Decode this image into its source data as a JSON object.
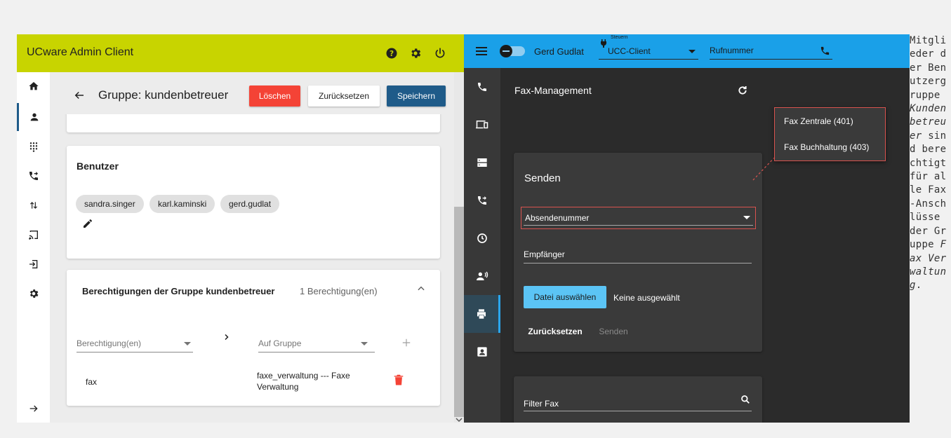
{
  "admin": {
    "title": "UCware Admin Client",
    "header_icons": [
      "help-icon",
      "gear-icon",
      "power-icon"
    ],
    "rail": [
      "home-icon",
      "person-icon",
      "dialpad-icon",
      "phone-forward-icon",
      "swap-vert-icon",
      "cast-icon",
      "login-icon",
      "gear-icon",
      "arrow-right-icon"
    ],
    "page_title": "Gruppe: kundenbetreuer",
    "buttons": {
      "delete": "Löschen",
      "reset": "Zurücksetzen",
      "save": "Speichern"
    },
    "users_card": {
      "title": "Benutzer",
      "chips": [
        "sandra.singer",
        "karl.kaminski",
        "gerd.gudlat"
      ]
    },
    "permissions_card": {
      "title": "Berechtigungen der Gruppe kundenbetreuer",
      "count": "1 Berechtigung(en)",
      "select_permission_placeholder": "Berechtigung(en)",
      "select_group_placeholder": "Auf Gruppe",
      "row": {
        "permission": "fax",
        "target": "faxe_verwaltung --- Faxe Verwaltung"
      }
    },
    "colors": {
      "header": "#c8d400",
      "delete": "#f44336",
      "save": "#1f5b89"
    }
  },
  "ucc": {
    "user_name": "Gerd Gudlat",
    "control_label": "Steuern",
    "control_value": "UCC-Client",
    "number_placeholder": "Rufnummer",
    "rail": [
      "phone-icon",
      "devices-icon",
      "storage-icon",
      "phone-forward-icon",
      "clock-icon",
      "voice-icon",
      "printer-icon",
      "contact-icon"
    ],
    "section_title": "Fax-Management",
    "send_card": {
      "title": "Senden",
      "sender_label": "Absendenummer",
      "recipient_label": "Empfänger",
      "file_button": "Datei auswählen",
      "file_status": "Keine ausgewählt",
      "reset": "Zurücksetzen",
      "send": "Senden"
    },
    "filter_label": "Filter Fax",
    "dropdown_options": [
      "Fax Zentrale (401)",
      "Fax Buchhaltung (403)"
    ],
    "colors": {
      "header": "#1aa0e8",
      "highlight": "#d9534f",
      "accent": "#5bc4f5"
    }
  },
  "caption": {
    "before": "Mitglieder der Benutzergruppe",
    "group": "Kundenbetreuer",
    "middle": "sind berechtigt für alle Fax-Anschlüsse der Gruppe",
    "target": "Fax Verwaltung",
    "end": "."
  }
}
